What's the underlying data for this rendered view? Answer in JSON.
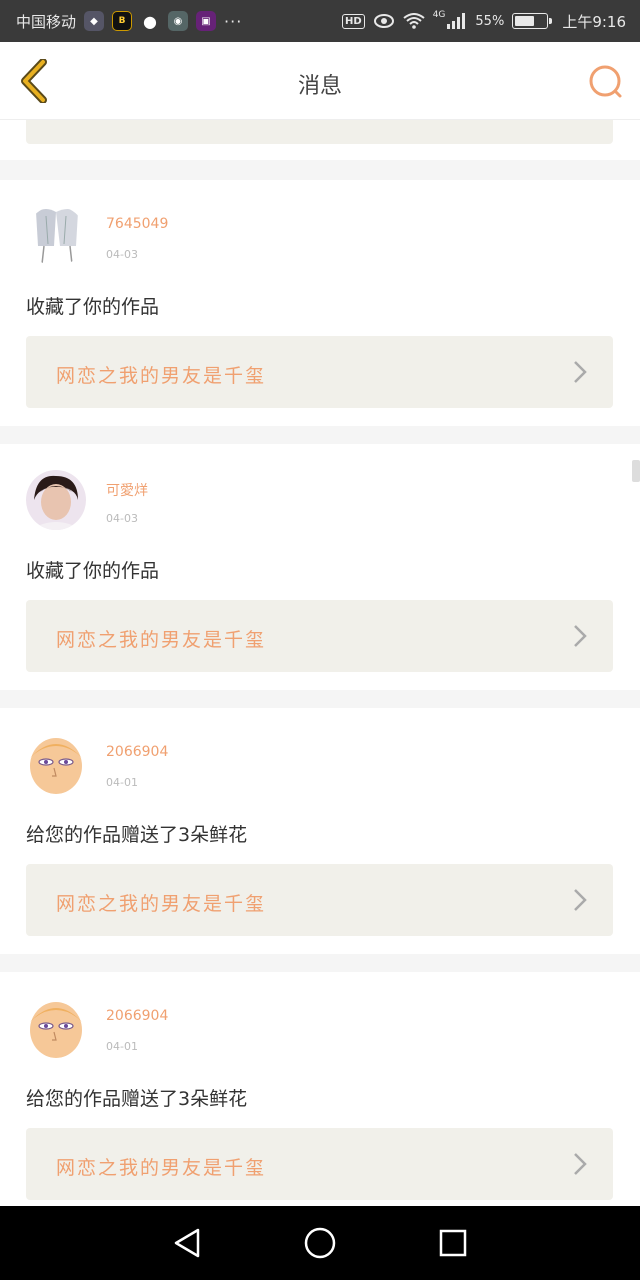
{
  "status_bar": {
    "carrier": "中国移动",
    "app_icons": [
      "shield-icon",
      "bilibili-icon",
      "wechat-icon",
      "qq-icon",
      "game-icon"
    ],
    "more": "···",
    "hd": "HD",
    "network": "4G",
    "speed": "55%",
    "time": "上午9:16"
  },
  "nav": {
    "title": "消息"
  },
  "colors": {
    "accent": "#f0a070",
    "back_arrow": "#e0a020",
    "card_bg": "#f1f0ea"
  },
  "messages": [
    {
      "username": "7645049",
      "date": "04-03",
      "text": "收藏了你的作品",
      "work_title": "网恋之我的男友是千玺"
    },
    {
      "username": "可愛烊",
      "date": "04-03",
      "text": "收藏了你的作品",
      "work_title": "网恋之我的男友是千玺"
    },
    {
      "username": "2066904",
      "date": "04-01",
      "text": "给您的作品赠送了3朵鲜花",
      "work_title": "网恋之我的男友是千玺"
    },
    {
      "username": "2066904",
      "date": "04-01",
      "text": "给您的作品赠送了3朵鲜花",
      "work_title": "网恋之我的男友是千玺"
    }
  ]
}
